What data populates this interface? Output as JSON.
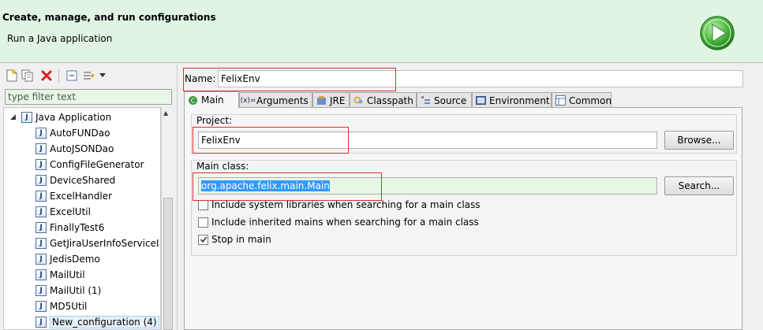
{
  "header": {
    "title": "Create, manage, and run configurations",
    "subtitle": "Run a Java application"
  },
  "left": {
    "filter_placeholder": "type filter text",
    "tree_root": "Java Application",
    "tree_items": [
      "AutoFUNDao",
      "AutoJSONDao",
      "ConfigFileGenerator",
      "DeviceShared",
      "ExcelHandler",
      "ExcelUtil",
      "FinallyTest6",
      "GetJiraUserInfoServiceI",
      "JedisDemo",
      "MailUtil",
      "MailUtil (1)",
      "MD5Util",
      "New_configuration (4)"
    ]
  },
  "right": {
    "name_label": "Name:",
    "name_value": "FelixEnv",
    "tabs": [
      {
        "label": "Main",
        "icon": "main-tab-icon"
      },
      {
        "label": "Arguments",
        "icon": "arguments-icon"
      },
      {
        "label": "JRE",
        "icon": "jre-icon"
      },
      {
        "label": "Classpath",
        "icon": "classpath-icon"
      },
      {
        "label": "Source",
        "icon": "source-icon"
      },
      {
        "label": "Environment",
        "icon": "environment-icon"
      },
      {
        "label": "Common",
        "icon": "common-icon"
      }
    ],
    "project_label": "Project:",
    "project_value": "FelixEnv",
    "browse_button": "Browse...",
    "main_class_label": "Main class:",
    "main_class_value": "org.apache.felix.main.Main",
    "search_button": "Search...",
    "options": [
      {
        "label": "Include system libraries when searching for a main class",
        "checked": false
      },
      {
        "label": "Include inherited mains when searching for a main class",
        "checked": false
      },
      {
        "label": "Stop in main",
        "checked": true
      }
    ]
  },
  "colors": {
    "header_bg": "#e0f4e3",
    "highlight_red": "#d93030",
    "selection_blue": "#3399ff"
  }
}
